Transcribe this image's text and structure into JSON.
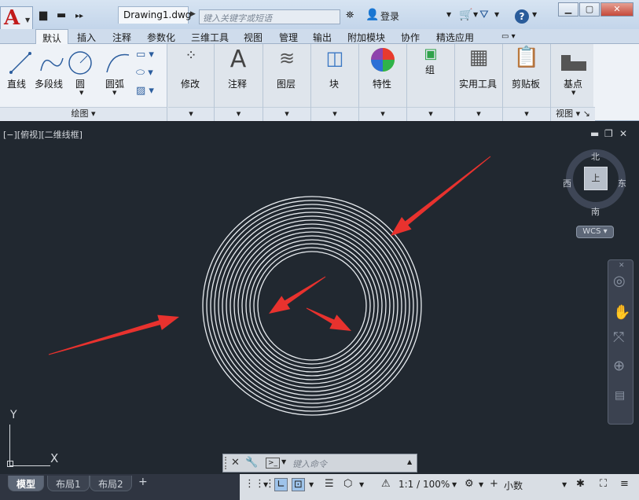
{
  "app": {
    "document_tab": "Drawing1.dwg",
    "search_placeholder": "键入关键字或短语",
    "login_label": "登录",
    "help_label": "?"
  },
  "ribbon_tabs": [
    "默认",
    "插入",
    "注释",
    "参数化",
    "三维工具",
    "视图",
    "管理",
    "输出",
    "附加模块",
    "协作",
    "精选应用"
  ],
  "draw_panel": {
    "tools": [
      "直线",
      "多段线",
      "圆",
      "圆弧"
    ],
    "footer": "绘图"
  },
  "panels": {
    "modify": "修改",
    "annotate": "注释",
    "layers": "图层",
    "block": "块",
    "properties": "特性",
    "group": "组",
    "utilities": "实用工具",
    "clipboard": "剪贴板",
    "base": "基点",
    "view_footer": "视图"
  },
  "viewport": {
    "label": "[−][俯视][二维线框]",
    "compass": {
      "north": "北",
      "south": "南",
      "east": "东",
      "west": "西"
    },
    "cube_face": "上",
    "wcs": "WCS"
  },
  "ucs": {
    "x": "X",
    "y": "Y"
  },
  "drawing": {
    "ring_count": 15,
    "outer_radius": 139,
    "inner_radius": 69,
    "line_color": "#e8ecf0",
    "arrow_color": "#e8322e"
  },
  "command_line": {
    "placeholder": "键入命令"
  },
  "layout_tabs": [
    "模型",
    "布局1",
    "布局2"
  ],
  "status": {
    "scale": "1:1 / 100%",
    "units": "小数"
  }
}
